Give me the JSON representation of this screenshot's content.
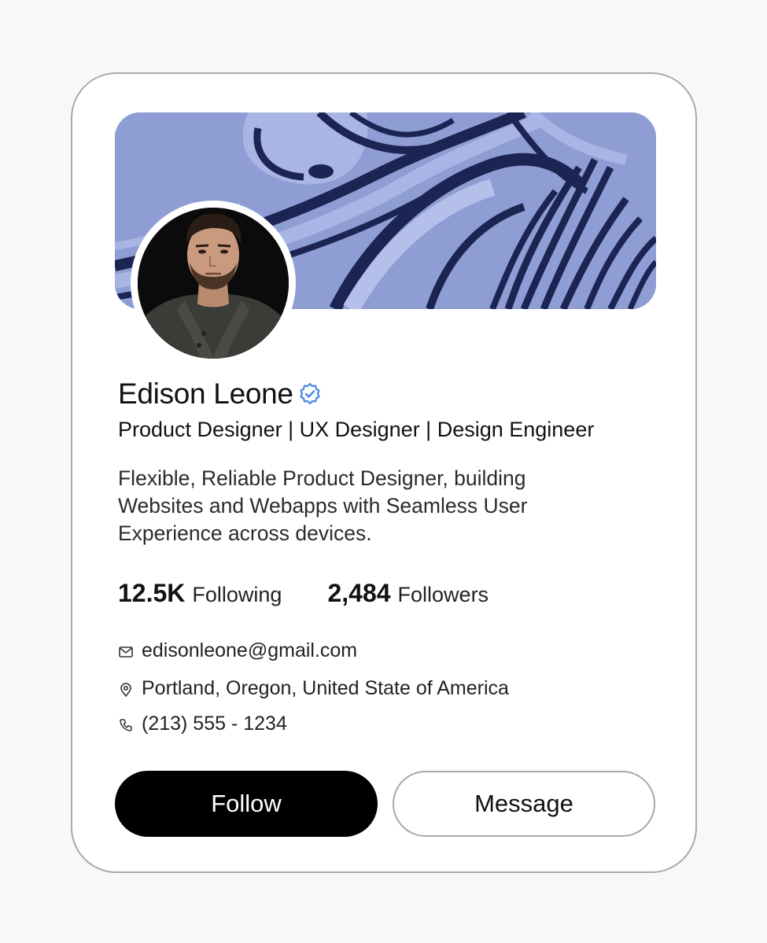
{
  "profile": {
    "name": "Edison Leone",
    "roles": "Product Designer | UX Designer | Design Engineer",
    "bio": "Flexible, Reliable Product Designer, building Websites and Webapps with Seamless User Experience across devices.",
    "verified_icon": "verified-badge-icon"
  },
  "stats": {
    "following_count": "12.5K",
    "following_label": "Following",
    "followers_count": "2,484",
    "followers_label": "Followers"
  },
  "contact": {
    "email": "edisonleone@gmail.com",
    "location": "Portland, Oregon, United State of America",
    "phone": "(213) 555 - 1234",
    "icons": [
      "mail-icon",
      "location-pin-icon",
      "phone-icon"
    ]
  },
  "actions": {
    "follow_label": "Follow",
    "message_label": "Message"
  },
  "colors": {
    "cover": "#8e9dd4",
    "verified": "#4a86e8",
    "follow_bg": "#000000",
    "card_border": "#a9a9a9"
  }
}
